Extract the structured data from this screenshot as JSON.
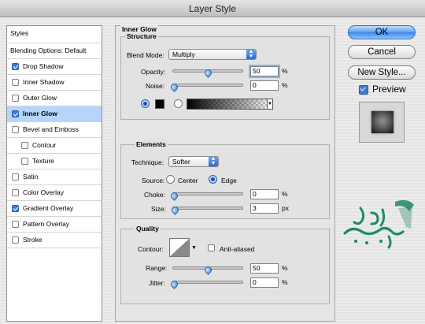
{
  "window": {
    "title": "Layer Style"
  },
  "styles_list": [
    {
      "label": "Styles",
      "type": "header",
      "checked": false,
      "selected": false
    },
    {
      "label": "Blending Options: Default",
      "type": "header",
      "checked": false,
      "selected": false
    },
    {
      "label": "Drop Shadow",
      "type": "item",
      "checked": true,
      "selected": false
    },
    {
      "label": "Inner Shadow",
      "type": "item",
      "checked": false,
      "selected": false
    },
    {
      "label": "Outer Glow",
      "type": "item",
      "checked": false,
      "selected": false
    },
    {
      "label": "Inner Glow",
      "type": "item",
      "checked": true,
      "selected": true
    },
    {
      "label": "Bevel and Emboss",
      "type": "item",
      "checked": false,
      "selected": false
    },
    {
      "label": "Contour",
      "type": "sub",
      "checked": false,
      "selected": false
    },
    {
      "label": "Texture",
      "type": "sub",
      "checked": false,
      "selected": false
    },
    {
      "label": "Satin",
      "type": "item",
      "checked": false,
      "selected": false
    },
    {
      "label": "Color Overlay",
      "type": "item",
      "checked": false,
      "selected": false
    },
    {
      "label": "Gradient Overlay",
      "type": "item",
      "checked": true,
      "selected": false
    },
    {
      "label": "Pattern Overlay",
      "type": "item",
      "checked": false,
      "selected": false
    },
    {
      "label": "Stroke",
      "type": "item",
      "checked": false,
      "selected": false
    }
  ],
  "inner_glow": {
    "title": "Inner Glow",
    "structure": {
      "title": "Structure",
      "blend_mode_label": "Blend Mode:",
      "blend_mode_value": "Multiply",
      "opacity_label": "Opacity:",
      "opacity_value": "50",
      "opacity_unit": "%",
      "opacity_level": 0.5,
      "noise_label": "Noise:",
      "noise_value": "0",
      "noise_unit": "%",
      "noise_level": 0.0,
      "fill_mode": "color",
      "color": "#000000"
    },
    "elements": {
      "title": "Elements",
      "technique_label": "Technique:",
      "technique_value": "Softer",
      "source_label": "Source:",
      "source_center": "Center",
      "source_edge": "Edge",
      "source_selected": "edge",
      "choke_label": "Choke:",
      "choke_value": "0",
      "choke_unit": "%",
      "choke_level": 0.0,
      "size_label": "Size:",
      "size_value": "3",
      "size_unit": "px",
      "size_level": 0.012
    },
    "quality": {
      "title": "Quality",
      "contour_label": "Contour:",
      "anti_aliased_label": "Anti-aliased",
      "anti_aliased_checked": false,
      "range_label": "Range:",
      "range_value": "50",
      "range_unit": "%",
      "range_level": 0.5,
      "jitter_label": "Jitter:",
      "jitter_value": "0",
      "jitter_unit": "%",
      "jitter_level": 0.0
    }
  },
  "buttons": {
    "ok": "OK",
    "cancel": "Cancel",
    "new_style": "New Style...",
    "preview_label": "Preview",
    "preview_checked": true
  },
  "colors": {
    "accent": "#3d86e6",
    "selection": "#b5d5fb",
    "logo_green": "#1f8a63"
  }
}
